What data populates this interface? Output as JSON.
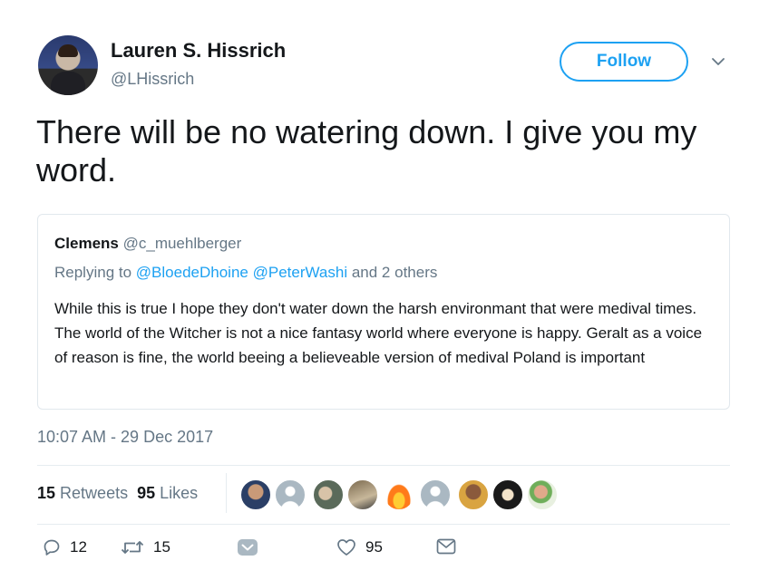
{
  "author": {
    "name": "Lauren S. Hissrich",
    "handle": "@LHissrich"
  },
  "follow_label": "Follow",
  "tweet_text": "There will be no watering down. I give you my word.",
  "quoted": {
    "name": "Clemens",
    "handle": "@c_muehlberger",
    "replying_prefix": "Replying to",
    "mention_1": "@BloedeDhoine",
    "mention_2": "@PeterWashi",
    "mention_suffix": "and 2 others",
    "body": "While this is true I hope they don't water down the harsh environmant that were medival times. The world of the Witcher is not a nice fantasy world where everyone is happy. Geralt as a voice of reason is fine, the world beeing a believeable version of medival Poland is important"
  },
  "timestamp": "10:07 AM - 29 Dec 2017",
  "stats": {
    "retweets_count": "15",
    "retweets_label": "Retweets",
    "likes_count": "95",
    "likes_label": "Likes"
  },
  "actions": {
    "replies": "12",
    "retweets": "15",
    "likes": "95"
  },
  "colors": {
    "accent": "#1da1f2",
    "muted": "#657786",
    "text": "#14171a",
    "border": "#e1e8ed"
  },
  "icons": [
    "chevron-down-icon",
    "reply-icon",
    "retweet-icon",
    "like-icon",
    "message-icon"
  ]
}
